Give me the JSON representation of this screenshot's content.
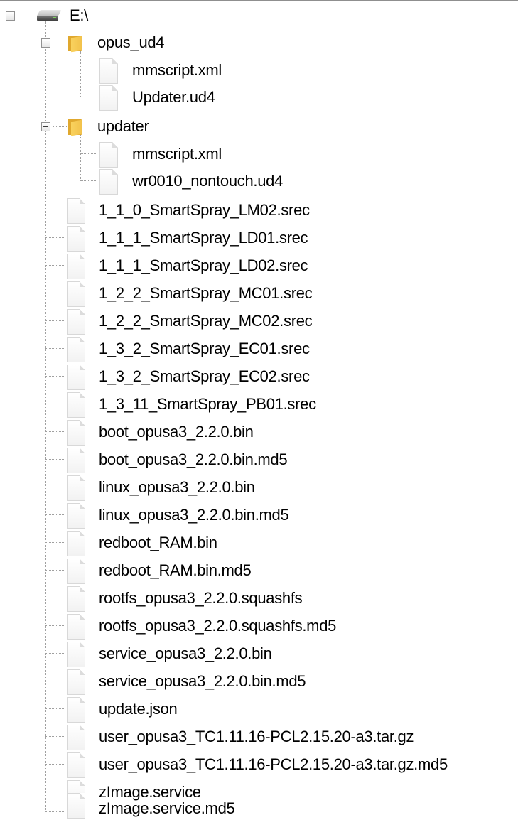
{
  "tree": {
    "root": {
      "label": "E:\\",
      "icon": "drive-icon",
      "expanded": true
    },
    "folders": [
      {
        "label": "opus_ud4",
        "icon": "folder-icon",
        "expanded": true,
        "children": [
          "mmscript.xml",
          "Updater.ud4"
        ]
      },
      {
        "label": "updater",
        "icon": "folder-icon",
        "expanded": true,
        "children": [
          "mmscript.xml",
          "wr0010_nontouch.ud4"
        ]
      }
    ],
    "files": [
      "1_1_0_SmartSpray_LM02.srec",
      "1_1_1_SmartSpray_LD01.srec",
      "1_1_1_SmartSpray_LD02.srec",
      "1_2_2_SmartSpray_MC01.srec",
      "1_2_2_SmartSpray_MC02.srec",
      "1_3_2_SmartSpray_EC01.srec",
      "1_3_2_SmartSpray_EC02.srec",
      "1_3_11_SmartSpray_PB01.srec",
      "boot_opusa3_2.2.0.bin",
      "boot_opusa3_2.2.0.bin.md5",
      "linux_opusa3_2.2.0.bin",
      "linux_opusa3_2.2.0.bin.md5",
      "redboot_RAM.bin",
      "redboot_RAM.bin.md5",
      "rootfs_opusa3_2.2.0.squashfs",
      "rootfs_opusa3_2.2.0.squashfs.md5",
      "service_opusa3_2.2.0.bin",
      "service_opusa3_2.2.0.bin.md5",
      "update.json",
      "user_opusa3_TC1.11.16-PCL2.15.20-a3.tar.gz",
      "user_opusa3_TC1.11.16-PCL2.15.20-a3.tar.gz.md5",
      "zImage.service",
      "zImage.service.md5"
    ],
    "colors": {
      "connector": "#a0a0a0",
      "folder": "#f2c14a",
      "text": "#000000"
    }
  }
}
